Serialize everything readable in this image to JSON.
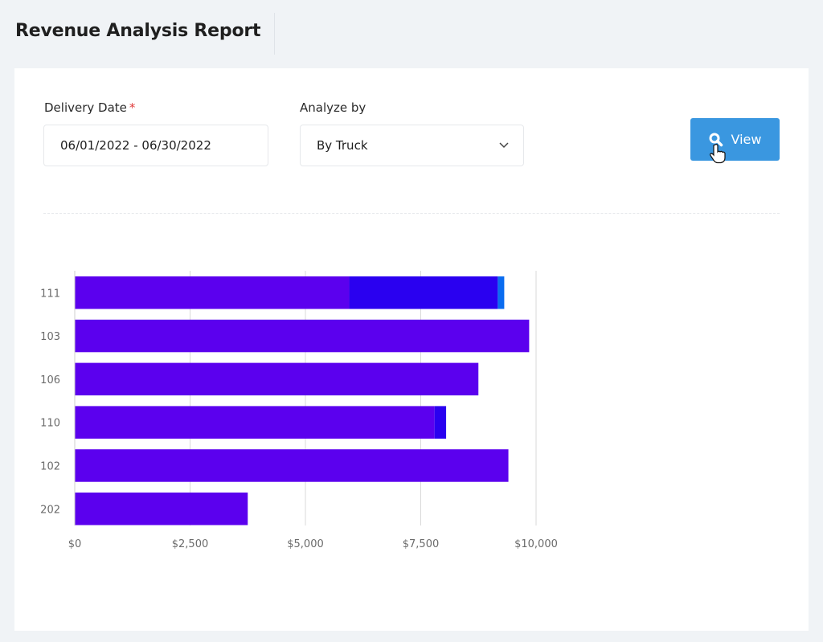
{
  "header": {
    "title": "Revenue Analysis Report"
  },
  "filters": {
    "delivery_date_label": "Delivery Date",
    "required_marker": "*",
    "delivery_date_value": "06/01/2022 - 06/30/2022",
    "analyze_by_label": "Analyze by",
    "analyze_by_value": "By Truck",
    "view_button_label": "View"
  },
  "icons": {
    "view": "search-icon",
    "dropdown": "chevron-down-icon",
    "cursor": "hand-pointer-icon"
  },
  "colors": {
    "bar_primary": "#5b00ee",
    "bar_secondary": "#2a00f0",
    "bar_tertiary": "#0a6cf0",
    "button": "#3a97e0",
    "required": "#e03a3a"
  },
  "chart_data": {
    "type": "bar",
    "orientation": "horizontal",
    "stacked": true,
    "categories": [
      "111",
      "103",
      "106",
      "110",
      "102",
      "202"
    ],
    "series": [
      {
        "values": [
          5950,
          9850,
          8750,
          7800,
          9400,
          3750
        ],
        "color": "#5b00ee"
      },
      {
        "values": [
          3220,
          0,
          0,
          250,
          0,
          0
        ],
        "color": "#2a00f0"
      },
      {
        "values": [
          140,
          0,
          0,
          0,
          0,
          0
        ],
        "color": "#0a6cf0"
      }
    ],
    "xticks": [
      "$0",
      "$2,500",
      "$5,000",
      "$7,500",
      "$10,000"
    ],
    "xtick_values": [
      0,
      2500,
      5000,
      7500,
      10000
    ],
    "xlim": [
      0,
      10000
    ],
    "grid": true,
    "legend": "none",
    "title": "",
    "xlabel": "",
    "ylabel": ""
  }
}
